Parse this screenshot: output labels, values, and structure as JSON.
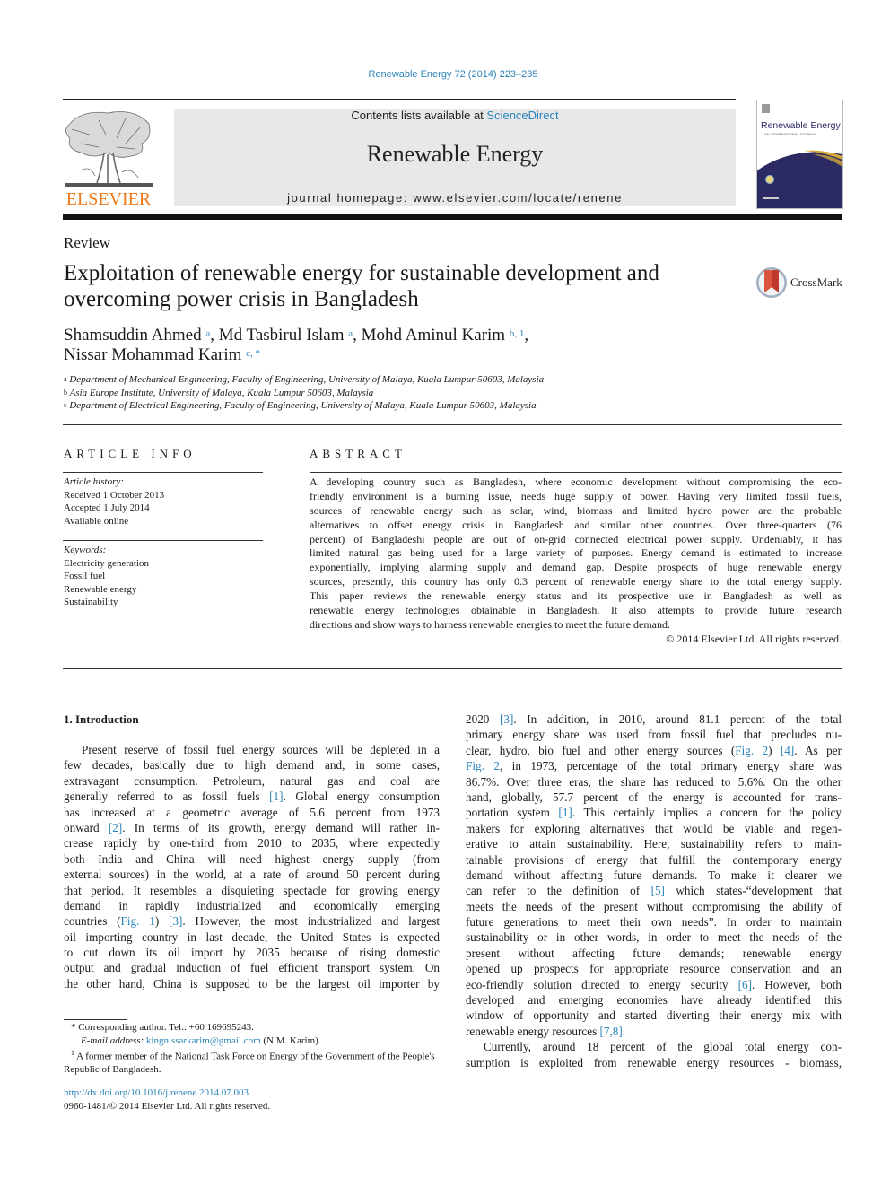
{
  "header": {
    "citation": "Renewable Energy 72 (2014) 223–235",
    "publisher_logo_word": "ELSEVIER",
    "contents_prefix": "Contents lists available at ",
    "contents_link": "ScienceDirect",
    "journal_name": "Renewable Energy",
    "homepage_prefix": "journal homepage: ",
    "homepage_url": "www.elsevier.com/locate/renene",
    "cover": {
      "title": "Renewable Energy",
      "subtitle": "AN INTERNATIONAL JOURNAL"
    },
    "colors": {
      "link": "#2a83b8",
      "elsevier_orange": "#f07a1a",
      "banner_gray": "#e8e8e8",
      "cover_navy": "#2b2a63",
      "cover_gold": "#d4a93a"
    }
  },
  "article": {
    "type": "Review",
    "title_lines": [
      "Exploitation of renewable energy for sustainable development and",
      "overcoming power crisis in Bangladesh"
    ],
    "crossmark_label": "CrossMark",
    "authors": [
      {
        "name": "Shamsuddin Ahmed",
        "sup": "a",
        "sep": ", "
      },
      {
        "name": "Md Tasbirul Islam",
        "sup": "a",
        "sep": ", "
      },
      {
        "name": "Mohd Aminul Karim",
        "sup": "b, 1",
        "sep": ","
      },
      {
        "name": "Nissar Mohammad Karim",
        "sup": "c, *",
        "sep": ""
      }
    ],
    "affiliations": [
      {
        "sup": "a",
        "text": "Department of Mechanical Engineering, Faculty of Engineering, University of Malaya, Kuala Lumpur 50603, Malaysia"
      },
      {
        "sup": "b",
        "text": "Asia Europe Institute, University of Malaya, Kuala Lumpur 50603, Malaysia"
      },
      {
        "sup": "c",
        "text": "Department of Electrical Engineering, Faculty of Engineering, University of Malaya, Kuala Lumpur 50603, Malaysia"
      }
    ]
  },
  "article_info": {
    "heading": "ARTICLE INFO",
    "history_label": "Article history:",
    "history": [
      "Received 1 October 2013",
      "Accepted 1 July 2014",
      "Available online"
    ],
    "keywords_label": "Keywords:",
    "keywords": [
      "Electricity generation",
      "Fossil fuel",
      "Renewable energy",
      "Sustainability"
    ]
  },
  "abstract": {
    "heading": "ABSTRACT",
    "lines": [
      "A developing country such as Bangladesh, where economic development without compromising the eco-",
      "friendly environment is a burning issue, needs huge supply of power. Having very limited fossil fuels,",
      "sources of renewable energy such as solar, wind, biomass and limited hydro power are the probable",
      "alternatives to offset energy crisis in Bangladesh and similar other countries. Over three-quarters (76",
      "percent) of Bangladeshi people are out of on-grid connected electrical power supply. Undeniably, it has",
      "limited natural gas being used for a large variety of purposes. Energy demand is estimated to increase",
      "exponentially, implying alarming supply and demand gap. Despite prospects of huge renewable energy",
      "sources, presently, this country has only 0.3 percent of renewable energy share to the total energy supply.",
      "This paper reviews the renewable energy status and its prospective use in Bangladesh as well as",
      "renewable energy technologies obtainable in Bangladesh. It also attempts to provide future research",
      "directions and show ways to harness renewable energies to meet the future demand."
    ],
    "copyright": "© 2014 Elsevier Ltd. All rights reserved."
  },
  "body": {
    "section_heading": "1.  Introduction",
    "left_lines": [
      [
        "Present reserve of fossil fuel energy sources will be depleted in a"
      ],
      [
        "few decades, basically due to high demand and, in some cases,"
      ],
      [
        "extravagant consumption. Petroleum, natural gas and coal are"
      ],
      [
        "generally referred to as fossil fuels ",
        {
          "ref": "[1]"
        },
        ". Global energy consumption"
      ],
      [
        "has increased at a geometric average of 5.6 percent from 1973"
      ],
      [
        "onward ",
        {
          "ref": "[2]"
        },
        ". In terms of its growth, energy demand will rather in-"
      ],
      [
        "crease rapidly by one-third from 2010 to 2035, where expectedly"
      ],
      [
        "both India and China will need highest energy supply (from"
      ],
      [
        "external sources) in the world, at a rate of around 50 percent during"
      ],
      [
        "that period. It resembles a disquieting spectacle for growing energy"
      ],
      [
        "demand in rapidly industrialized and economically emerging"
      ],
      [
        "countries (",
        {
          "ref": "Fig. 1"
        },
        ") ",
        {
          "ref": "[3]"
        },
        ". However, the most industrialized and largest"
      ],
      [
        "oil importing country in last decade, the United States is expected"
      ],
      [
        "to cut down its oil import by 2035 because of rising domestic"
      ],
      [
        "output and gradual induction of fuel efficient transport system. On"
      ],
      [
        "the other hand, China is supposed to be the largest oil importer by"
      ]
    ],
    "right_lines": [
      [
        "2020 ",
        {
          "ref": "[3]"
        },
        ". In addition, in 2010, around 81.1 percent of the total"
      ],
      [
        "primary energy share was used from fossil fuel that precludes nu-"
      ],
      [
        "clear, hydro, bio fuel and other energy sources (",
        {
          "ref": "Fig. 2"
        },
        ") ",
        {
          "ref": "[4]"
        },
        ". As per"
      ],
      [
        {
          "ref": "Fig. 2"
        },
        ", in 1973, percentage of the total primary energy share was"
      ],
      [
        "86.7%. Over three eras, the share has reduced to 5.6%. On the other"
      ],
      [
        "hand, globally, 57.7 percent of the energy is accounted for trans-"
      ],
      [
        "portation system ",
        {
          "ref": "[1]"
        },
        ". This certainly implies a concern for the policy"
      ],
      [
        "makers for exploring alternatives that would be viable and regen-"
      ],
      [
        "erative to attain sustainability. Here, sustainability refers to main-"
      ],
      [
        "tainable provisions of energy that fulfill the contemporary energy"
      ],
      [
        "demand without affecting future demands. To make it clearer we"
      ],
      [
        "can refer to the definition of ",
        {
          "ref": "[5]"
        },
        " which states-“development that"
      ],
      [
        "meets the needs of the present without compromising the ability of"
      ],
      [
        "future generations to meet their own needs”. In order to maintain"
      ],
      [
        "sustainability or in other words, in order to meet the needs of the"
      ],
      [
        "present without affecting future demands; renewable energy"
      ],
      [
        "opened up prospects for appropriate resource conservation and an"
      ],
      [
        "eco-friendly solution directed to energy security ",
        {
          "ref": "[6]"
        },
        ". However, both"
      ],
      [
        "developed and emerging economies have already identified this"
      ],
      [
        "window of opportunity and started diverting their energy mix with"
      ],
      [
        "renewable energy resources ",
        {
          "ref": "[7,8]"
        },
        "."
      ],
      [
        "Currently, around 18 percent of the global total energy con-"
      ],
      [
        "sumption is exploited from renewable energy resources - biomass,"
      ]
    ],
    "right_last_para_lines": [
      20
    ],
    "right_indent_lines": [
      21
    ]
  },
  "footnotes": {
    "corresponding": "*  Corresponding author. Tel.: +60 169695243.",
    "email_label": "E-mail address: ",
    "email": "kingnissarkarim@gmail.com",
    "email_suffix": " (N.M. Karim).",
    "note1_mark": "1",
    "note1": "  A former member of the National Task Force on Energy of the Government of the People's Republic of Bangladesh.",
    "doi": "http://dx.doi.org/10.1016/j.renene.2014.07.003",
    "issn": "0960-1481/© 2014 Elsevier Ltd. All rights reserved."
  }
}
